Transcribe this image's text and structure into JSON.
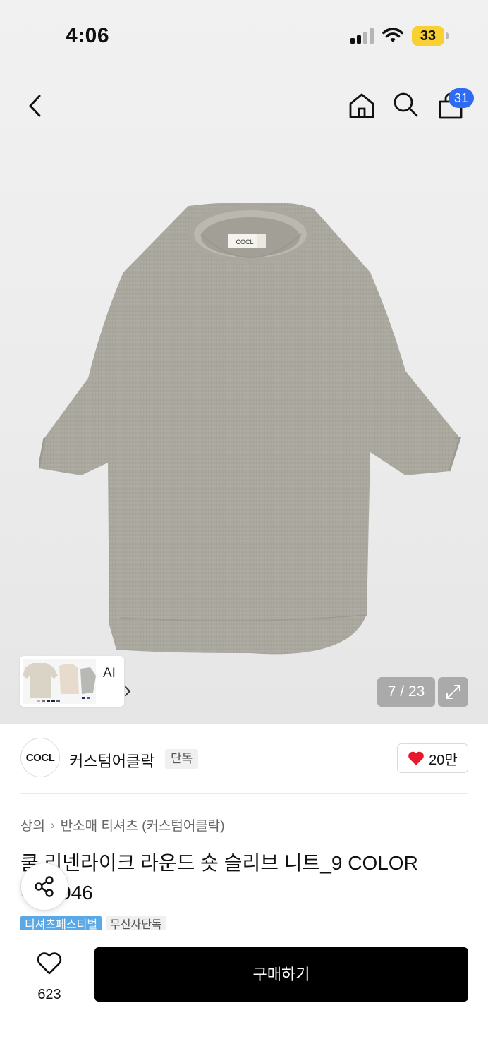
{
  "status_bar": {
    "time": "4:06",
    "battery_level": "33"
  },
  "nav": {
    "cart_count": "31"
  },
  "gallery": {
    "counter": "7 / 23",
    "ai_label": "AI",
    "image_color": "#a9a79e"
  },
  "brand": {
    "logo_text": "COCL",
    "name": "커스텀어클락",
    "tag": "단독",
    "like_count": "20만"
  },
  "product": {
    "breadcrumb": [
      "상의",
      "반소매 티셔츠 (커스텀어클락)"
    ],
    "title": "쿨 리넨라이크 라운드 숏 슬리브 니트_9 COLOR CKT046",
    "tags": [
      "티셔츠페스티벌",
      "무신사단독"
    ]
  },
  "bottom": {
    "wish_count": "623",
    "buy_label": "구매하기"
  },
  "colors": {
    "accent_blue": "#2f6bf0",
    "heart_red": "#e8192c",
    "tag_blue": "#5aa9e6"
  }
}
